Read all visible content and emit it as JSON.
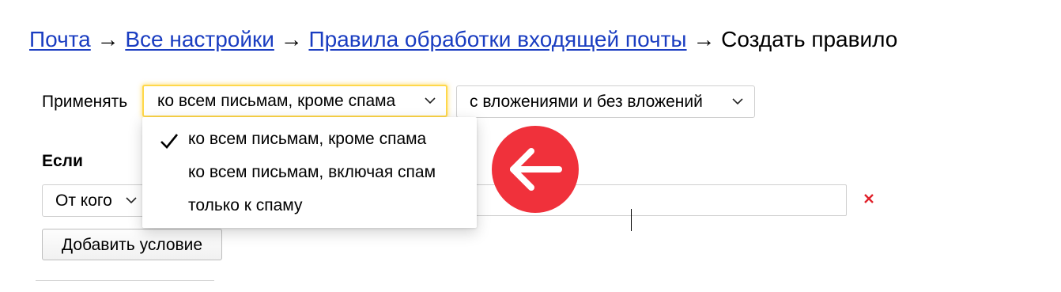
{
  "breadcrumb": {
    "items": [
      "Почта",
      "Все настройки",
      "Правила обработки входящей почты"
    ],
    "separator": "→",
    "current": "Создать правило"
  },
  "apply": {
    "label": "Применять",
    "scope_selected": "ко всем письмам, кроме спама",
    "attachments_selected": "с вложениями и без вложений"
  },
  "dropdown": {
    "options": [
      {
        "label": "ко всем письмам, кроме спама",
        "selected": true
      },
      {
        "label": "ко всем письмам, включая спам",
        "selected": false
      },
      {
        "label": "только к спаму",
        "selected": false
      }
    ]
  },
  "condition": {
    "heading": "Если",
    "field_selected": "От кого",
    "value": "",
    "remove_icon": "close-icon"
  },
  "actions": {
    "add_condition_label": "Добавить условие"
  },
  "overlay": {
    "icon": "arrow-left-icon"
  },
  "colors": {
    "link": "#1a3dc1",
    "focus": "#ffd84a",
    "remove": "#e0202a",
    "badge": "#f0313b"
  }
}
